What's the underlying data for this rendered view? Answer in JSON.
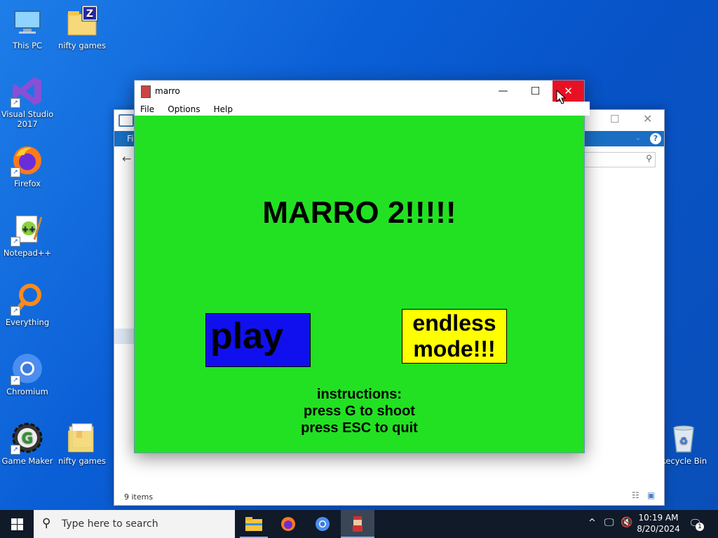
{
  "desktop": {
    "icons": [
      {
        "label": "This PC",
        "icon": "pc-icon"
      },
      {
        "label": "nifty games",
        "icon": "zip-folder-icon"
      },
      {
        "label": "Visual Studio 2017",
        "icon": "visual-studio-icon"
      },
      {
        "label": "Firefox",
        "icon": "firefox-icon"
      },
      {
        "label": "Notepad++",
        "icon": "notepad-plus-plus-icon"
      },
      {
        "label": "Everything",
        "icon": "everything-search-icon"
      },
      {
        "label": "Chromium",
        "icon": "chromium-icon"
      },
      {
        "label": "Game Maker",
        "icon": "game-maker-icon"
      },
      {
        "label": "nifty games",
        "icon": "folder-icon"
      },
      {
        "label": "Recycle Bin",
        "icon": "recycle-bin-icon"
      }
    ]
  },
  "explorer": {
    "status_items": "9 items",
    "ribbon_tab_partial": "Fi",
    "colors": {
      "ribbon": "#1a6fc4"
    }
  },
  "game_window": {
    "title": "marro",
    "menu": [
      "File",
      "Options",
      "Help"
    ],
    "canvas": {
      "background": "#22e122",
      "title": "MARRO 2!!!!!",
      "play_label": "play",
      "play_color": "#1010ee",
      "endless_line1": "endless",
      "endless_line2": "mode!!!",
      "endless_color": "#ffff00",
      "instructions": [
        "instructions:",
        "press G to shoot",
        "press ESC to quit"
      ]
    }
  },
  "taskbar": {
    "search_placeholder": "Type here to search",
    "time": "10:19 AM",
    "date": "8/20/2024",
    "notification_count": "1"
  }
}
